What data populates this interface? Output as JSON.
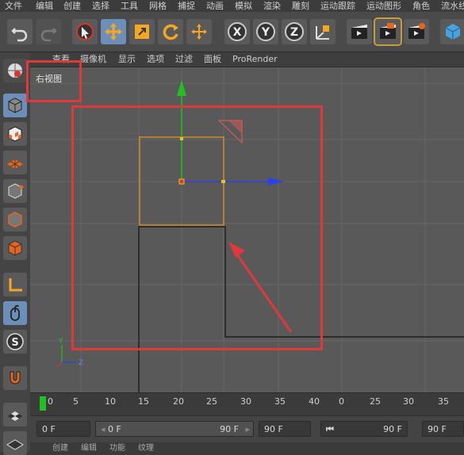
{
  "menu": [
    "文件",
    "编辑",
    "创建",
    "选择",
    "工具",
    "网格",
    "捕捉",
    "动画",
    "模拟",
    "渲染",
    "雕刻",
    "运动跟踪",
    "运动图形",
    "角色",
    "流水线"
  ],
  "toolbar_icons": [
    "undo-icon",
    "redo-icon",
    "live-select-icon",
    "move-icon",
    "scale-icon",
    "rotate-icon",
    "move-alt-icon",
    "x-axis-icon",
    "y-axis-icon",
    "z-axis-icon",
    "coordinate-system-icon",
    "render-view-icon",
    "render-picture-viewer-icon",
    "render-settings-icon",
    "cube-icon"
  ],
  "viewport_menu": [
    "查看",
    "摄像机",
    "显示",
    "选项",
    "过滤",
    "面板",
    "ProRender"
  ],
  "viewport_label": "右视图",
  "axis": {
    "y": "Y",
    "z": "Z"
  },
  "timeline": {
    "ticks": [
      "0",
      "5",
      "10",
      "15",
      "20",
      "25",
      "30",
      "35",
      "40",
      "0",
      "25",
      "30",
      "35"
    ]
  },
  "transport": {
    "start_field": "0 F",
    "range_left": "0 F",
    "range_right": "90 F",
    "end_field": "90 F",
    "field5": "90 F",
    "field6": "90 F"
  },
  "bottom": [
    "创建",
    "编辑",
    "功能",
    "纹理"
  ],
  "colors": {
    "accent": "#e0393b",
    "axis_y": "#23c023",
    "axis_z": "#2a43e8",
    "selection": "#c89b3c"
  }
}
